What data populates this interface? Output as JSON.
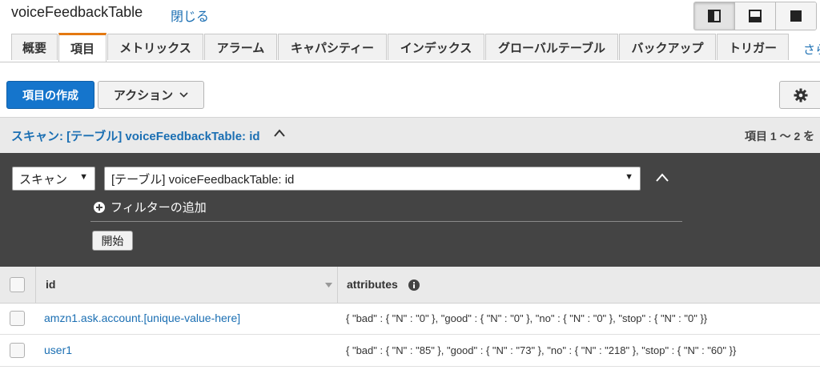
{
  "header": {
    "title": "voiceFeedbackTable",
    "close_label": "閉じる"
  },
  "tabs": [
    {
      "label": "概要"
    },
    {
      "label": "項目"
    },
    {
      "label": "メトリックス"
    },
    {
      "label": "アラーム"
    },
    {
      "label": "キャパシティー"
    },
    {
      "label": "インデックス"
    },
    {
      "label": "グローバルテーブル"
    },
    {
      "label": "バックアップ"
    },
    {
      "label": "トリガー"
    }
  ],
  "tabs_more": "さら",
  "toolbar": {
    "create_label": "項目の作成",
    "actions_label": "アクション"
  },
  "scan": {
    "title": "スキャン: [テーブル] voiceFeedbackTable: id",
    "count": "項目 1 ～ 2 を",
    "mode": "スキャン",
    "target": "[テーブル] voiceFeedbackTable: id",
    "add_filter": "フィルターの追加",
    "start": "開始"
  },
  "table": {
    "columns": [
      "id",
      "attributes"
    ],
    "rows": [
      {
        "id": "amzn1.ask.account.[unique-value-here]",
        "attributes": "{ \"bad\" : { \"N\" : \"0\" }, \"good\" : { \"N\" : \"0\" }, \"no\" : { \"N\" : \"0\" }, \"stop\" : { \"N\" : \"0\" }}"
      },
      {
        "id": "user1",
        "attributes": "{ \"bad\" : { \"N\" : \"85\" }, \"good\" : { \"N\" : \"73\" }, \"no\" : { \"N\" : \"218\" }, \"stop\" : { \"N\" : \"60\" }}"
      }
    ]
  },
  "colors": {
    "accent": "#1575cc",
    "active_tab": "#e47911",
    "dark_panel": "#444444"
  }
}
